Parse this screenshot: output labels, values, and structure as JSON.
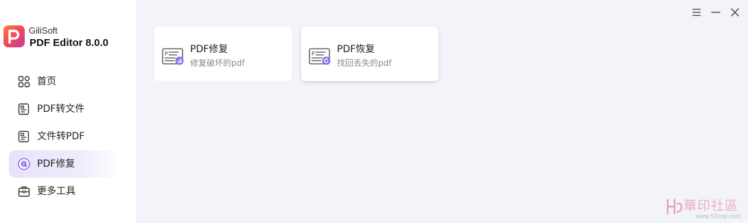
{
  "brand": {
    "company": "GiliSoft",
    "product": "PDF Editor 8.0.0",
    "logo_icon": "pdf-editor-logo-icon"
  },
  "sidebar": {
    "items": [
      {
        "label": "首页",
        "icon": "home-grid-icon",
        "active": false
      },
      {
        "label": "PDF转文件",
        "icon": "pdf-to-file-icon",
        "active": false
      },
      {
        "label": "文件转PDF",
        "icon": "file-to-pdf-icon",
        "active": false
      },
      {
        "label": "PDF修复",
        "icon": "pdf-repair-icon",
        "active": true
      },
      {
        "label": "更多工具",
        "icon": "toolbox-icon",
        "active": false
      }
    ]
  },
  "window_controls": {
    "menu_icon": "hamburger-menu-icon",
    "minimize_icon": "minimize-icon",
    "close_icon": "close-icon"
  },
  "cards": [
    {
      "title": "PDF修复",
      "subtitle": "修复破坏的pdf",
      "icon": "pdf-repair-tool-icon"
    },
    {
      "title": "PDF恢复",
      "subtitle": "找回丢失的pdf",
      "icon": "pdf-recover-tool-icon"
    }
  ],
  "watermark": {
    "text": "華印社區",
    "url": "www.52cnp.com"
  },
  "colors": {
    "accent": "#7b5cf0",
    "sidebar_active_bg": "#e8e3fb",
    "content_bg": "#f3f4fa"
  }
}
